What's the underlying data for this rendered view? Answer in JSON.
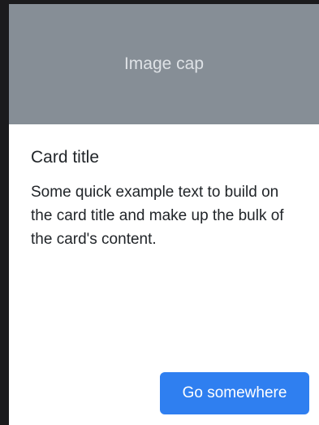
{
  "card": {
    "image_cap_text": "Image cap",
    "title": "Card title",
    "text": "Some quick example text to build on the card title and make up the bulk of the card's content.",
    "button_label": "Go somewhere"
  },
  "colors": {
    "background": "#1b1b1d",
    "card_background": "#ffffff",
    "image_cap_background": "#868e96",
    "button_background": "#2f7ff0"
  }
}
